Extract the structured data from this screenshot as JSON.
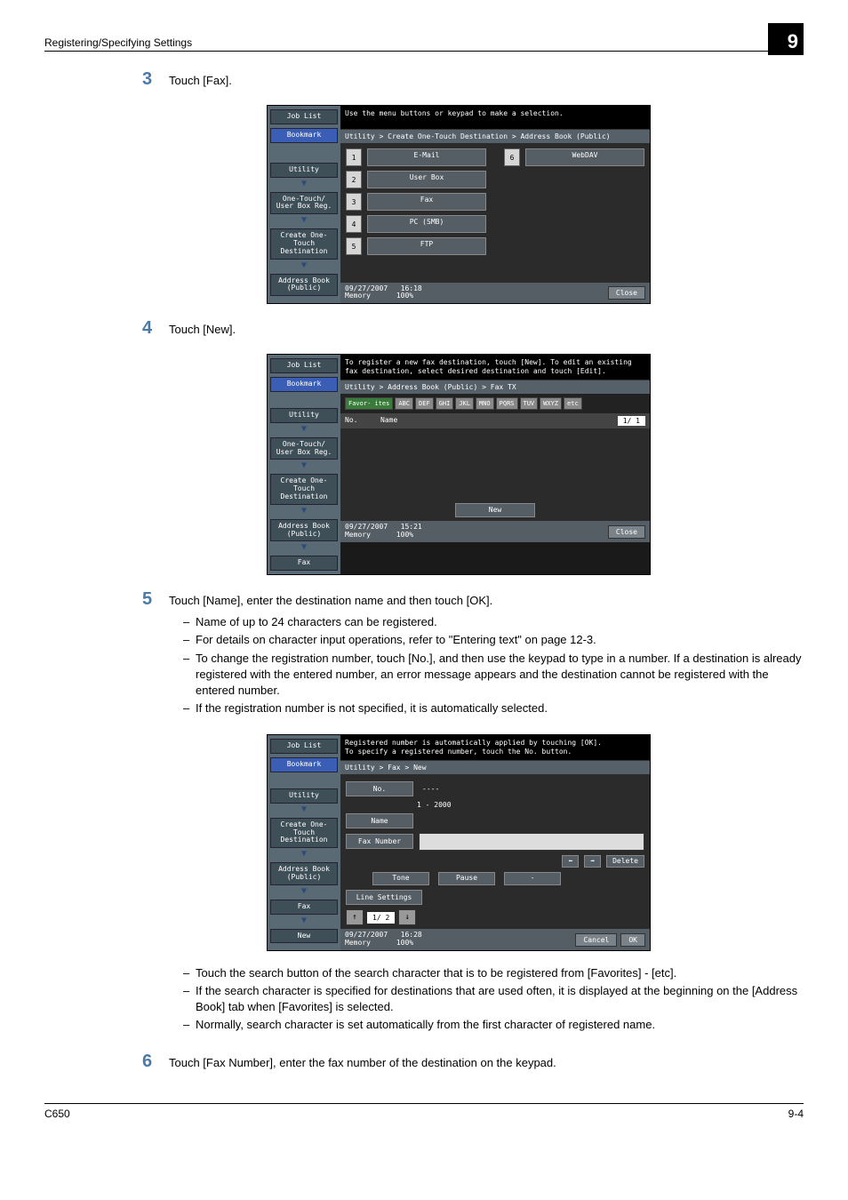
{
  "header": {
    "title": "Registering/Specifying Settings",
    "chapter": "9"
  },
  "steps": {
    "s3": {
      "num": "3",
      "text": "Touch [Fax]."
    },
    "s4": {
      "num": "4",
      "text": "Touch [New]."
    },
    "s5": {
      "num": "5",
      "text": "Touch [Name], enter the destination name and then touch [OK].",
      "sub_a": [
        "Name of up to 24 characters can be registered.",
        "For details on character input operations, refer to \"Entering text\" on page 12-3.",
        "To change the registration number, touch [No.], and then use the keypad to type in a number. If a destination is already registered with the entered number, an error message appears and the destination cannot be registered with the entered number.",
        "If the registration number is not specified, it is automatically selected."
      ],
      "sub_b": [
        "Touch the search button of the search character that is to be registered from [Favorites] - [etc].",
        "If the search character is specified for destinations that are used often, it is displayed at the beginning on the [Address Book] tab when [Favorites] is selected.",
        "Normally, search character is set automatically from the first character of registered name."
      ]
    },
    "s6": {
      "num": "6",
      "text": "Touch [Fax Number], enter the fax number of the destination on the keypad."
    }
  },
  "shot1": {
    "side": [
      "Job List",
      "Bookmark",
      "Utility",
      "One-Touch/\nUser Box Reg.",
      "Create One-Touch\nDestination",
      "Address Book\n(Public)"
    ],
    "msg": "Use the menu buttons or keypad to make a selection.",
    "path": "Utility > Create One-Touch Destination > Address Book (Public)",
    "items": [
      {
        "n": "1",
        "l": "E-Mail"
      },
      {
        "n": "2",
        "l": "User Box"
      },
      {
        "n": "3",
        "l": "Fax"
      },
      {
        "n": "4",
        "l": "PC (SMB)"
      },
      {
        "n": "5",
        "l": "FTP"
      }
    ],
    "item6": {
      "n": "6",
      "l": "WebDAV"
    },
    "foot": {
      "date": "09/27/2007",
      "time": "16:18",
      "mem": "Memory",
      "pct": "100%",
      "close": "Close"
    }
  },
  "shot2": {
    "side": [
      "Job List",
      "Bookmark",
      "Utility",
      "One-Touch/\nUser Box Reg.",
      "Create One-Touch\nDestination",
      "Address Book\n(Public)",
      "Fax"
    ],
    "msg": "To register a new fax destination, touch [New]. To edit an existing fax destination, select desired destination and touch [Edit].",
    "path": "Utility > Address Book (Public) > Fax TX",
    "alpha": [
      "Favor-\nites",
      "ABC",
      "DEF",
      "GHI",
      "JKL",
      "MNO",
      "PQRS",
      "TUV",
      "WXYZ",
      "etc"
    ],
    "hdr": {
      "c1": "No.",
      "c2": "Name",
      "pg": "1/  1"
    },
    "new": "New",
    "foot": {
      "date": "09/27/2007",
      "time": "15:21",
      "mem": "Memory",
      "pct": "100%",
      "close": "Close"
    }
  },
  "shot3": {
    "side": [
      "Job List",
      "Bookmark",
      "Utility",
      "Create One-Touch\nDestination",
      "Address Book\n(Public)",
      "Fax",
      "New"
    ],
    "msg": "Registered number is automatically applied by touching [OK].\nTo specify a registered number, touch the No. button.",
    "path": "Utility > Fax > New",
    "form": {
      "no_lbl": "No.",
      "no_val": "----",
      "no_range": "1 - 2000",
      "name_lbl": "Name",
      "fax_lbl": "Fax Number",
      "del": "Delete",
      "tone": "Tone",
      "pause": "Pause",
      "dash": "-",
      "line": "Line Settings",
      "pg": "1/ 2"
    },
    "foot": {
      "date": "09/27/2007",
      "time": "16:28",
      "mem": "Memory",
      "pct": "100%",
      "cancel": "Cancel",
      "ok": "OK"
    }
  },
  "footer": {
    "left": "C650",
    "right": "9-4"
  }
}
